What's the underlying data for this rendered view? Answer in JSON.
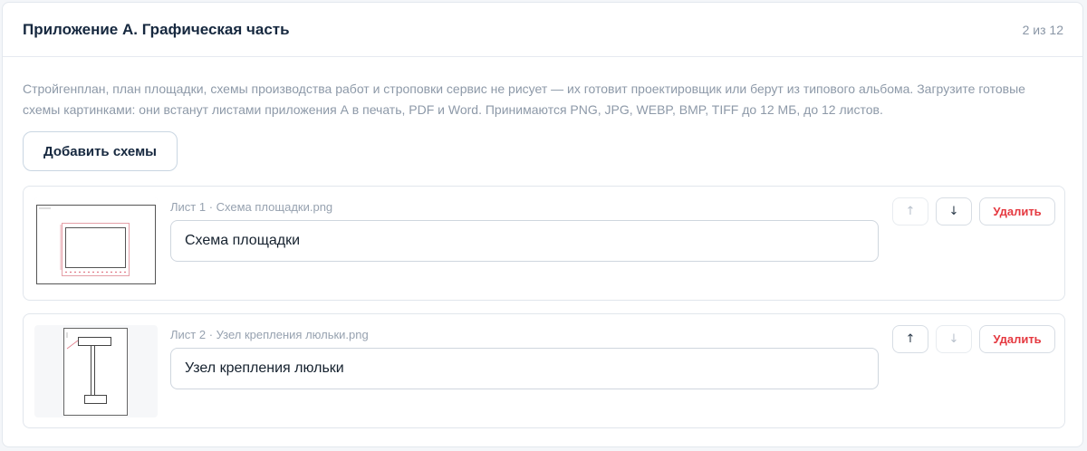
{
  "header": {
    "title": "Приложение А. Графическая часть",
    "counter": "2 из 12"
  },
  "description": "Стройгенплан, план площадки, схемы производства работ и строповки сервис не рисует — их готовит проектировщик или берут из типового альбома. Загрузите готовые схемы картинками: они встанут листами приложения А в печать, PDF и Word. Принимаются PNG, JPG, WEBP, BMP, TIFF до 12 МБ, до 12 листов.",
  "add_button_label": "Добавить схемы",
  "sheets": [
    {
      "caption": "Лист 1 · Схема площадки.png",
      "name_value": "Схема площадки",
      "up_icon": "↑",
      "down_icon": "↓",
      "up_disabled": true,
      "down_disabled": false,
      "delete_label": "Удалить"
    },
    {
      "caption": "Лист 2 · Узел крепления люльки.png",
      "name_value": "Узел крепления люльки",
      "up_icon": "↑",
      "down_icon": "↓",
      "up_disabled": false,
      "down_disabled": true,
      "delete_label": "Удалить"
    }
  ],
  "colors": {
    "title": "#16283f",
    "muted": "#8d99a8",
    "danger": "#e53940",
    "border": "#e1e6ec"
  }
}
